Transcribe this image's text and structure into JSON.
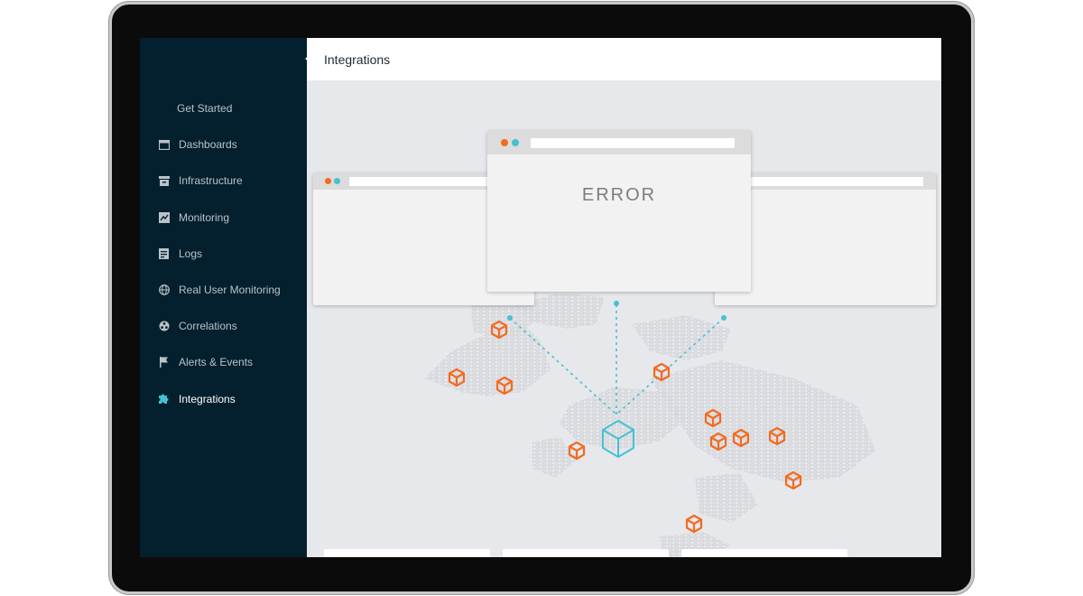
{
  "sidebar": {
    "items": [
      {
        "label": "Get Started",
        "icon": "none"
      },
      {
        "label": "Dashboards",
        "icon": "dashboard-icon"
      },
      {
        "label": "Infrastructure",
        "icon": "infrastructure-icon"
      },
      {
        "label": "Monitoring",
        "icon": "monitoring-icon"
      },
      {
        "label": "Logs",
        "icon": "logs-icon"
      },
      {
        "label": "Real User Monitoring",
        "icon": "globe-icon"
      },
      {
        "label": "Correlations",
        "icon": "correlations-icon"
      },
      {
        "label": "Alerts & Events",
        "icon": "flag-icon"
      },
      {
        "label": "Integrations",
        "icon": "puzzle-icon",
        "active": true
      }
    ]
  },
  "header": {
    "title": "Integrations"
  },
  "illustration": {
    "error_label": "ERROR",
    "colors": {
      "orange": "#f26b21",
      "teal": "#45c1cf",
      "sidebar_bg": "#04202e",
      "map": "#d2d4d8"
    }
  }
}
